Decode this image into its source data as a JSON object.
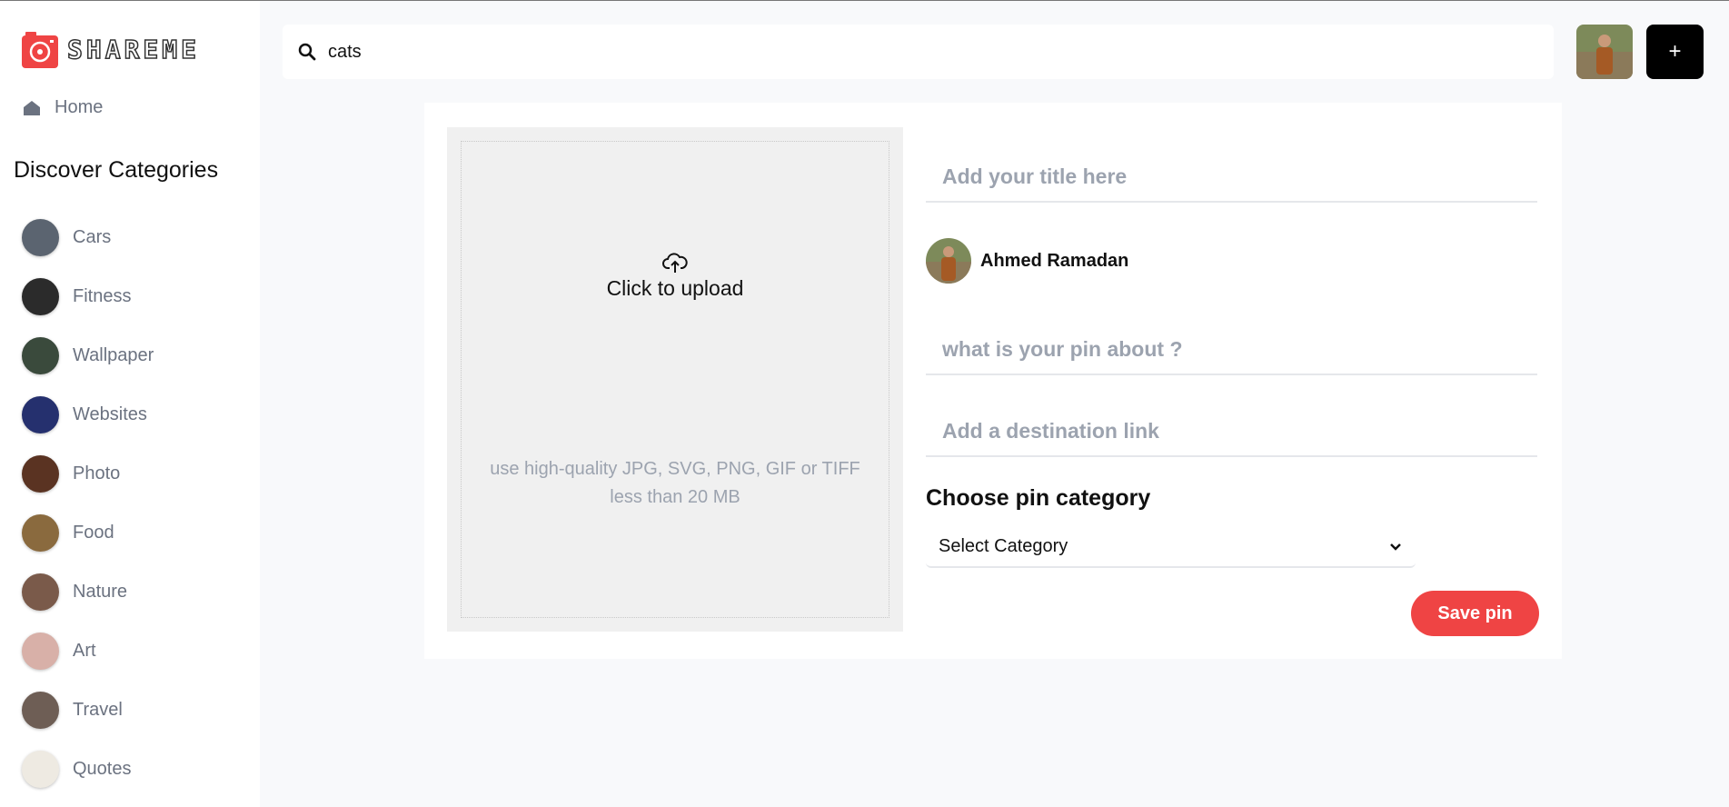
{
  "app": {
    "logo_text": "SHAREME",
    "brand_color": "#ef4444"
  },
  "sidebar": {
    "home_label": "Home",
    "discover_title": "Discover Categories",
    "categories": [
      {
        "label": "Cars",
        "color": "#5b6470"
      },
      {
        "label": "Fitness",
        "color": "#2b2b2b"
      },
      {
        "label": "Wallpaper",
        "color": "#3a4a3c"
      },
      {
        "label": "Websites",
        "color": "#25306e"
      },
      {
        "label": "Photo",
        "color": "#5a3322"
      },
      {
        "label": "Food",
        "color": "#8a6a3e"
      },
      {
        "label": "Nature",
        "color": "#7a5a4a"
      },
      {
        "label": "Art",
        "color": "#d8b0a8"
      },
      {
        "label": "Travel",
        "color": "#6e5e55"
      },
      {
        "label": "Quotes",
        "color": "#eeeae2"
      }
    ]
  },
  "search": {
    "value": "cats"
  },
  "header": {
    "add_label": "+"
  },
  "form": {
    "upload": {
      "click_label": "Click to upload",
      "hint": "use high-quality JPG, SVG, PNG, GIF or TIFF less than 20 MB"
    },
    "title_placeholder": "Add your title here",
    "user_name": "Ahmed Ramadan",
    "about_placeholder": "what is your pin about ?",
    "link_placeholder": "Add a destination link",
    "category_label": "Choose pin category",
    "category_selected": "Select Category",
    "save_label": "Save pin"
  }
}
